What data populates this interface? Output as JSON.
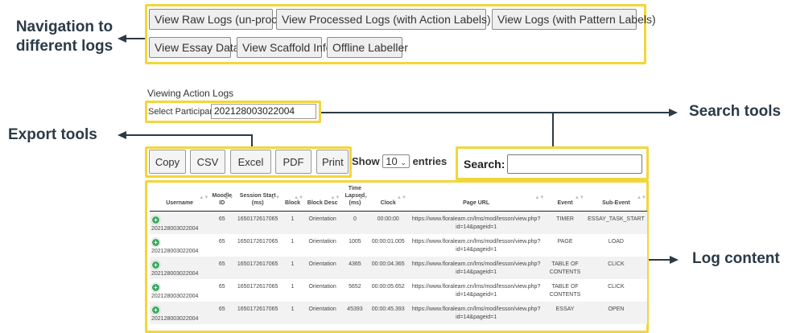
{
  "nav": {
    "buttons": [
      "View Raw Logs (un-processed)",
      "View Processed Logs (with Action Labels)",
      "View Logs (with Pattern Labels)",
      "View Essay Data",
      "View Scaffold Info",
      "Offline Labeller"
    ]
  },
  "annotations": {
    "navigation": "Navigation to different logs",
    "export": "Export tools",
    "search": "Search tools",
    "content": "Log content",
    "highlight_color": "#f2d63a"
  },
  "view": {
    "heading": "Viewing Action Logs",
    "select_label": "Select Participant:",
    "participant": "202128003022004"
  },
  "export": {
    "buttons": [
      "Copy",
      "CSV",
      "Excel",
      "PDF",
      "Print"
    ]
  },
  "length": {
    "prefix": "Show",
    "value": "10",
    "suffix": "entries"
  },
  "search": {
    "label": "Search:",
    "value": ""
  },
  "table": {
    "headers": [
      "Username",
      "Moodle ID",
      "Session Start (ms)",
      "Block",
      "Block Desc",
      "Time Lapsed (ms)",
      "Clock",
      "Page URL",
      "Event",
      "Sub-Event"
    ],
    "rows": [
      [
        "202128003022004",
        "65",
        "1650172617065",
        "1",
        "Orientation",
        "0",
        "00:00:00",
        "https://www.floraleam.cn/lms/mod/lesson/view.php?id=14&pageid=1",
        "TIMER",
        "ESSAY_TASK_START"
      ],
      [
        "202128003022004",
        "65",
        "1650172617065",
        "1",
        "Orientation",
        "1005",
        "00:00:01.005",
        "https://www.floraleam.cn/lms/mod/lesson/view.php?id=14&pageid=1",
        "PAGE",
        "LOAD"
      ],
      [
        "202128003022004",
        "65",
        "1650172617065",
        "1",
        "Orientation",
        "4365",
        "00:00:04.365",
        "https://www.floraleam.cn/lms/mod/lesson/view.php?id=14&pageid=1",
        "TABLE OF CONTENTS",
        "CLICK"
      ],
      [
        "202128003022004",
        "65",
        "1650172617065",
        "1",
        "Orientation",
        "5652",
        "00:00:05.652",
        "https://www.floraleam.cn/lms/mod/lesson/view.php?id=14&pageid=1",
        "TABLE OF CONTENTS",
        "CLICK"
      ],
      [
        "202128003022004",
        "65",
        "1650172617065",
        "1",
        "Orientation",
        "45393",
        "00:00:45.393",
        "https://www.floraleam.cn/lms/mod/lesson/view.php?id=14&pageid=1",
        "ESSAY",
        "OPEN"
      ]
    ]
  }
}
